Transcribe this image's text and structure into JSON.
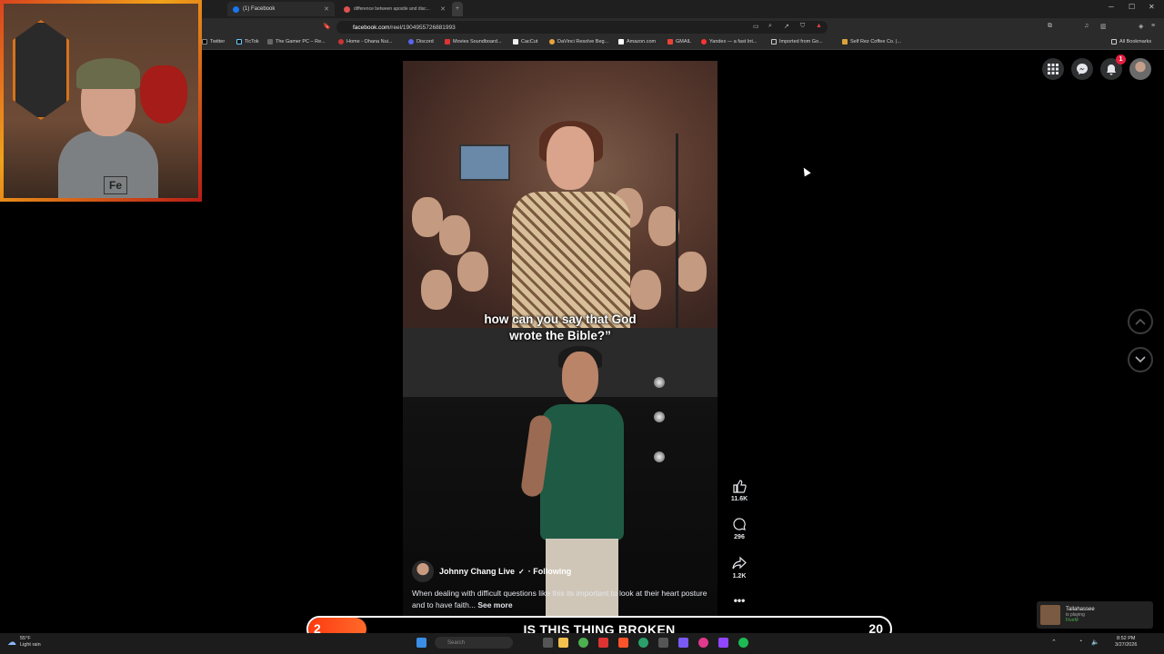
{
  "browser": {
    "tabs": [
      {
        "label": "(1) Facebook",
        "active": true
      },
      {
        "label": "difference between apostle and disc...",
        "active": false
      }
    ],
    "url_host": "facebook.com",
    "url_path": "/reel/1904955726881993",
    "bookmarks": [
      "Twitter",
      "TicTok",
      "The Gamer PC – Re...",
      "Home - Ohana Nui...",
      "Discord",
      "Movies Soundboard...",
      "CacCut",
      "DaVinci Resolve Beg...",
      "Amazon.com",
      "GMAIL",
      "Yandex — a fast Int...",
      "Imported from Go...",
      "Self Rez Coffee Co. |..."
    ],
    "all_bookmarks": "All Bookmarks"
  },
  "webcam": {
    "shirt_text": "Fe"
  },
  "reel": {
    "caption_line1": "how can you say that God",
    "caption_line2": "wrote the Bible?”",
    "likes": "11.6K",
    "comments": "296",
    "shares": "1.2K",
    "author": "Johnny Chang Live",
    "follow_status": "· Following",
    "description": "When dealing with difficult questions like this its important to look at their heart posture and to have faith... ",
    "see_more": "See more"
  },
  "facebook": {
    "notification_count": "1"
  },
  "overlay": {
    "left_number": "2",
    "title": "IS THIS THING BROKEN",
    "right_number": "20",
    "progress": 0.1
  },
  "taskbar": {
    "temp": "55°F",
    "weather": "Light rain",
    "search_placeholder": "Search",
    "time": "8:52 PM",
    "date": "3/27/2026"
  },
  "toast": {
    "title": "Tallahassee",
    "subtitle": "is playing",
    "app": "FiveM"
  },
  "colors": {
    "accent": "#ff4a1c",
    "fb_badge": "#e41e3f",
    "background": "#000000"
  }
}
